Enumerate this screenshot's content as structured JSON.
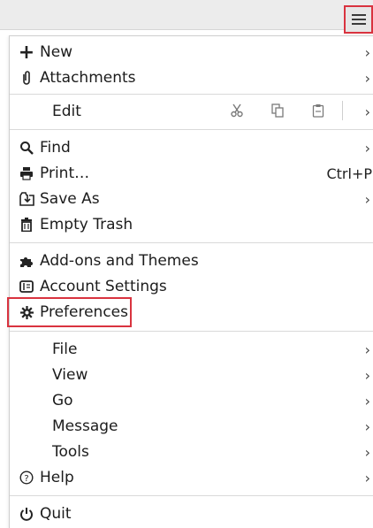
{
  "menu": {
    "new": "New",
    "attachments": "Attachments",
    "edit": "Edit",
    "find": "Find",
    "print": "Print…",
    "print_shortcut": "Ctrl+P",
    "save_as": "Save As",
    "empty_trash": "Empty Trash",
    "addons": "Add-ons and Themes",
    "account_settings": "Account Settings",
    "preferences": "Preferences",
    "file": "File",
    "view": "View",
    "go": "Go",
    "message": "Message",
    "tools": "Tools",
    "help": "Help",
    "quit": "Quit"
  },
  "glyphs": {
    "arrow": "›",
    "plus": "+",
    "paperclip": "⌀",
    "cut": "✂",
    "copy": "⧉",
    "paste": "📋",
    "search": "🔍",
    "printer": "🖶",
    "save": "⤓",
    "trash": "🗑",
    "puzzle": "🧩",
    "account": "▣",
    "gear": "✲",
    "help": "?",
    "power": "⏻"
  },
  "colors": {
    "highlight": "#d9333f"
  }
}
